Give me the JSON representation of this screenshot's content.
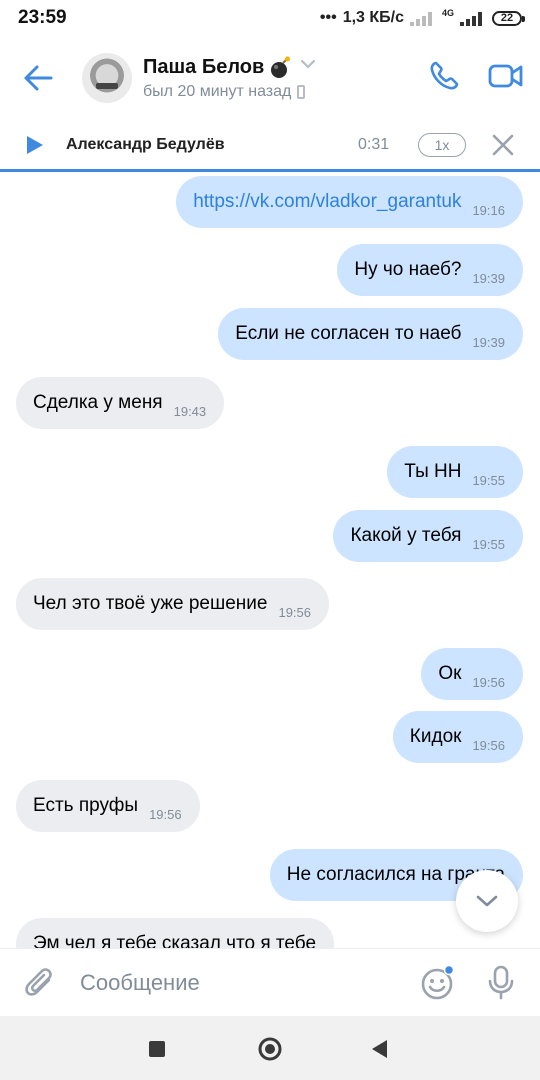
{
  "status_bar": {
    "time": "23:59",
    "net_speed": "1,3 КБ/с",
    "network": "4G",
    "battery": "22"
  },
  "header": {
    "contact_name": "Паша Белов",
    "last_seen": "был 20 минут назад",
    "accent_color": "#3f8ae0"
  },
  "player": {
    "track": "Александр Бедулёв",
    "time": "0:31",
    "speed": "1x"
  },
  "messages": [
    {
      "dir": "out",
      "text": "https://vk.com/vladkor_garantuk",
      "time": "19:16",
      "link": true
    },
    {
      "dir": "out",
      "text": "Ну чо наеб?",
      "time": "19:39"
    },
    {
      "dir": "out",
      "text": "Если не согласен то наеб",
      "time": "19:39"
    },
    {
      "dir": "in",
      "text": "Сделка у меня",
      "time": "19:43"
    },
    {
      "dir": "out",
      "text": "Ты НН",
      "time": "19:55"
    },
    {
      "dir": "out",
      "text": "Какой у тебя",
      "time": "19:55"
    },
    {
      "dir": "in",
      "text": "Чел это твоё уже решение",
      "time": "19:56"
    },
    {
      "dir": "out",
      "text": "Ок",
      "time": "19:56"
    },
    {
      "dir": "out",
      "text": "Кидок",
      "time": "19:56"
    },
    {
      "dir": "in",
      "text": "Есть пруфы",
      "time": "19:56"
    },
    {
      "dir": "out",
      "text": "Не согласился на гранта",
      "time": ""
    },
    {
      "dir": "in",
      "text": "Эм чел я тебе сказал что я тебе",
      "time": ""
    }
  ],
  "composer": {
    "placeholder": "Сообщение"
  },
  "colors": {
    "outgoing_bubble": "#cce4ff",
    "incoming_bubble": "#ebedf0",
    "icon_blue": "#3f8ae0"
  }
}
